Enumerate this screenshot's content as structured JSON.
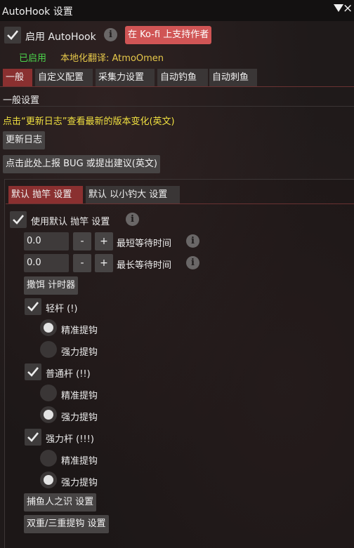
{
  "window": {
    "title": "AutoHook 设置",
    "collapse_icon": "triangle-down-icon",
    "close_icon": "close-icon"
  },
  "header": {
    "enable_label": "启用 AutoHook",
    "enable_checked": true,
    "kofi_label": "在 Ko-fi 上支持作者",
    "status": "已启用",
    "translator": "本地化翻译: AtmoOmen",
    "colors": {
      "status": "#4cd74c",
      "translator": "#e6c84a",
      "kofi": "#d05555",
      "active_tab": "#8a3030",
      "notice": "#f0e040"
    }
  },
  "tabs": [
    {
      "label": "一般",
      "active": true
    },
    {
      "label": "自定义配置",
      "active": false
    },
    {
      "label": "采集力设置",
      "active": false
    },
    {
      "label": "自动钓鱼",
      "active": false
    },
    {
      "label": "自动刺鱼",
      "active": false
    }
  ],
  "general": {
    "section_title": "一般设置",
    "notice": "点击“更新日志”查看最新的版本变化(英文)",
    "changelog_button": "更新日志",
    "report_button": "点击此处上报 BUG 或提出建议(英文)"
  },
  "subtabs": [
    {
      "label": "默认 抛竿 设置",
      "active": true
    },
    {
      "label": "默认 以小钓大 设置",
      "active": false
    }
  ],
  "cast_settings": {
    "use_default_label": "使用默认 抛竿 设置",
    "use_default_checked": true,
    "min_wait": {
      "value": "0.0",
      "minus": "-",
      "plus": "+",
      "label": "最短等待时间"
    },
    "max_wait": {
      "value": "0.0",
      "minus": "-",
      "plus": "+",
      "label": "最长等待时间"
    },
    "bait_timer_button": "撒饵 计时器",
    "light": {
      "label": "轻杆 (!)",
      "checked": true,
      "options": [
        "精准提钩",
        "强力提钩"
      ],
      "selected": 0
    },
    "medium": {
      "label": "普通杆 (!!)",
      "checked": true,
      "options": [
        "精准提钩",
        "强力提钩"
      ],
      "selected": 1
    },
    "heavy": {
      "label": "强力杆 (!!!)",
      "checked": true,
      "options": [
        "精准提钩",
        "强力提钩"
      ],
      "selected": 1
    },
    "fishers_intuition_button": "捕鱼人之识 设置",
    "double_triple_button": "双重/三重提钩 设置"
  }
}
